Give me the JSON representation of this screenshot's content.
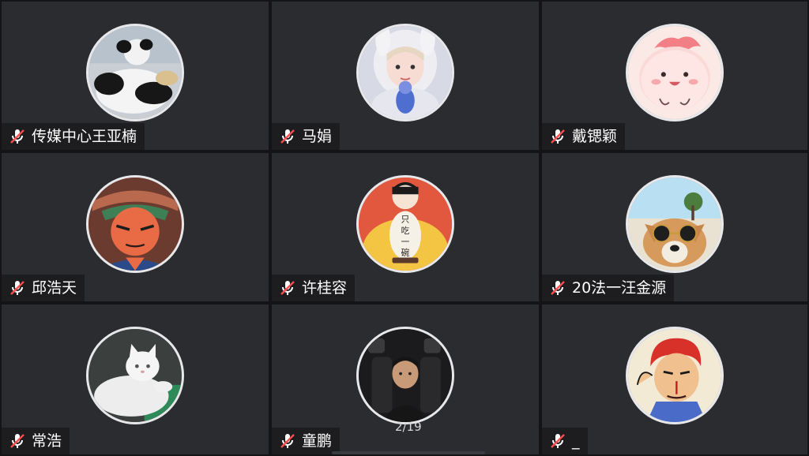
{
  "participants": [
    {
      "name": "传媒中心王亚楠",
      "muted": true,
      "avatar": "panda-avatar"
    },
    {
      "name": "马娟",
      "muted": true,
      "avatar": "girl-bunny-hood-avatar"
    },
    {
      "name": "戴锶颖",
      "muted": true,
      "avatar": "pink-cartoon-avatar"
    },
    {
      "name": "邱浩天",
      "muted": true,
      "avatar": "anime-character-avatar"
    },
    {
      "name": "许桂容",
      "muted": true,
      "avatar": "rice-bowl-cartoon-avatar",
      "avatar_text": "只吃一碗"
    },
    {
      "name": "20法一汪金源",
      "muted": true,
      "avatar": "dog-sunglasses-avatar"
    },
    {
      "name": "常浩",
      "muted": true,
      "avatar": "white-cat-avatar"
    },
    {
      "name": "童鹏",
      "muted": true,
      "avatar": "boy-in-car-avatar"
    },
    {
      "name": "_",
      "muted": true,
      "avatar": "red-hair-comic-avatar"
    }
  ],
  "pager": "2/19",
  "colors": {
    "tile_bg": "#2b2c30",
    "mute_red": "#ff4d4f",
    "text": "#ffffff"
  }
}
